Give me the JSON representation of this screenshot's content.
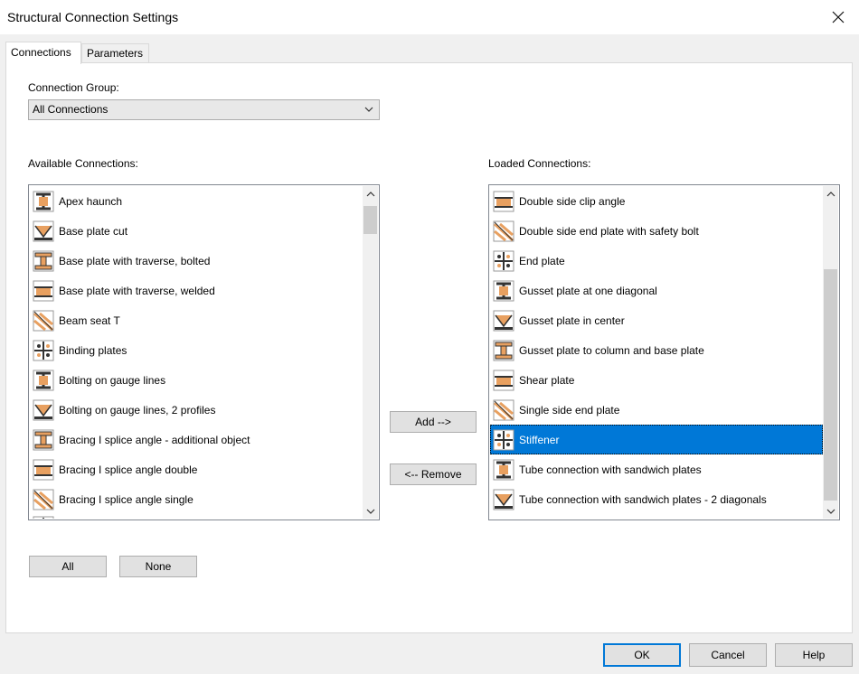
{
  "window": {
    "title": "Structural Connection Settings"
  },
  "tabs": [
    {
      "label": "Connections"
    },
    {
      "label": "Parameters"
    }
  ],
  "connection_group": {
    "label": "Connection Group:",
    "value": "All Connections"
  },
  "available": {
    "label": "Available Connections:",
    "items": [
      {
        "label": "Apex haunch",
        "icon": "apex-haunch-icon"
      },
      {
        "label": "Base plate cut",
        "icon": "base-plate-cut-icon"
      },
      {
        "label": "Base plate with traverse, bolted",
        "icon": "base-plate-traverse-bolted-icon"
      },
      {
        "label": "Base plate with traverse, welded",
        "icon": "base-plate-traverse-welded-icon"
      },
      {
        "label": "Beam seat T",
        "icon": "beam-seat-t-icon"
      },
      {
        "label": "Binding plates",
        "icon": "binding-plates-icon"
      },
      {
        "label": "Bolting on gauge lines",
        "icon": "bolting-gauge-lines-icon"
      },
      {
        "label": "Bolting on gauge lines, 2 profiles",
        "icon": "bolting-gauge-lines-2-profiles-icon"
      },
      {
        "label": "Bracing I splice angle - additional object",
        "icon": "bracing-splice-additional-icon"
      },
      {
        "label": "Bracing I splice angle double",
        "icon": "bracing-splice-double-icon"
      },
      {
        "label": "Bracing I splice angle single",
        "icon": "bracing-splice-single-icon"
      }
    ]
  },
  "loaded": {
    "label": "Loaded Connections:",
    "items": [
      {
        "label": "Double side clip angle",
        "icon": "double-side-clip-angle-icon"
      },
      {
        "label": "Double side end plate with safety bolt",
        "icon": "double-side-end-plate-safety-bolt-icon"
      },
      {
        "label": "End plate",
        "icon": "end-plate-icon"
      },
      {
        "label": "Gusset plate at one diagonal",
        "icon": "gusset-plate-one-diagonal-icon"
      },
      {
        "label": "Gusset plate in center",
        "icon": "gusset-plate-center-icon"
      },
      {
        "label": "Gusset plate to column and base plate",
        "icon": "gusset-plate-column-base-icon"
      },
      {
        "label": "Shear plate",
        "icon": "shear-plate-icon"
      },
      {
        "label": "Single side end plate",
        "icon": "single-side-end-plate-icon"
      },
      {
        "label": "Stiffener",
        "icon": "stiffener-icon",
        "selected": true
      },
      {
        "label": "Tube connection with sandwich plates",
        "icon": "tube-sandwich-plates-icon"
      },
      {
        "label": "Tube connection with sandwich plates - 2 diagonals",
        "icon": "tube-sandwich-plates-2-diagonals-icon"
      }
    ]
  },
  "buttons": {
    "add": "Add -->",
    "remove": "<-- Remove",
    "all": "All",
    "none": "None",
    "ok": "OK",
    "cancel": "Cancel",
    "help": "Help"
  },
  "colors": {
    "selection": "#0078d7",
    "icon_orange": "#e8a060",
    "icon_dark": "#333333"
  }
}
